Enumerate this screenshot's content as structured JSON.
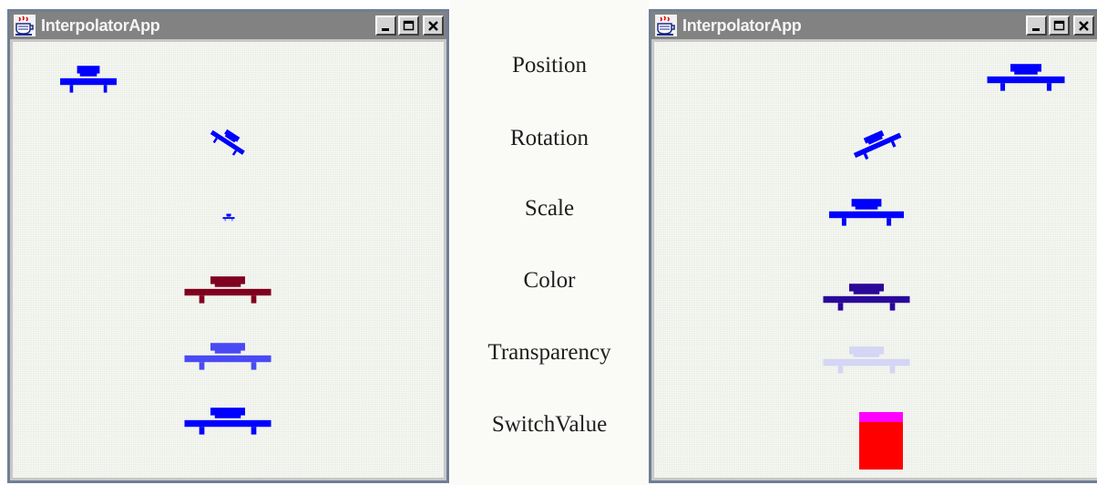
{
  "windows": [
    {
      "id": "left",
      "title": "InterpolatorApp",
      "controls": {
        "minimize": "minimize",
        "maximize": "maximize",
        "close": "close"
      }
    },
    {
      "id": "right",
      "title": "InterpolatorApp",
      "controls": {
        "minimize": "minimize",
        "maximize": "maximize",
        "close": "close"
      }
    }
  ],
  "labels": [
    "Position",
    "Rotation",
    "Scale",
    "Color",
    "Transparency",
    "SwitchValue"
  ],
  "colors": {
    "car_blue": "#0000ff",
    "car_dark_red": "#800020",
    "car_transparent_left": "#4a4af5",
    "car_indigo": "#2a0899",
    "car_transparent_right": "#d5d5f5",
    "switch_top": "#ff00ff",
    "switch_body": "#ff0000",
    "titlebar": "#828282",
    "window_frame": "#6f7f95"
  },
  "icons": {
    "app": "java-coffee-cup-icon",
    "minimize": "minimize-icon",
    "maximize": "maximize-icon",
    "close": "close-icon"
  }
}
